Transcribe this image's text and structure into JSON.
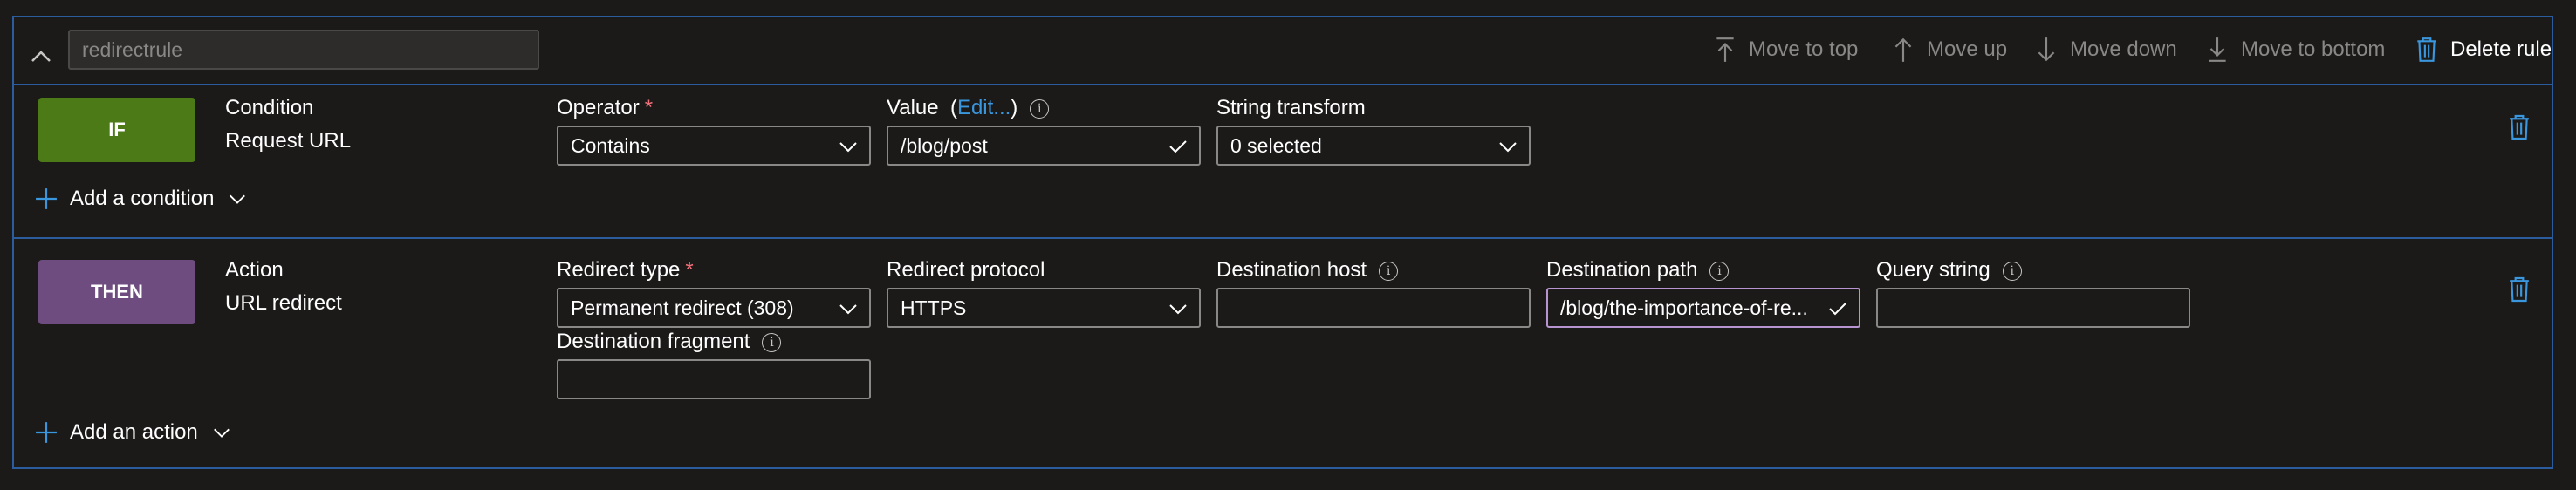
{
  "header": {
    "rule_name_placeholder": "redirectrule",
    "toolbar": {
      "move_to_top": "Move to top",
      "move_up": "Move up",
      "move_down": "Move down",
      "move_to_bottom": "Move to bottom",
      "delete_rule": "Delete rule"
    }
  },
  "condition": {
    "badge": "IF",
    "title": "Condition",
    "type": "Request URL",
    "operator_label": "Operator",
    "operator_value": "Contains",
    "value_label": "Value",
    "value_edit_link": "Edit...",
    "value_value": "/blog/post",
    "string_transform_label": "String transform",
    "string_transform_value": "0 selected",
    "add_label": "Add a condition"
  },
  "action": {
    "badge": "THEN",
    "title": "Action",
    "type": "URL redirect",
    "redirect_type_label": "Redirect type",
    "redirect_type_value": "Permanent redirect (308)",
    "redirect_protocol_label": "Redirect protocol",
    "redirect_protocol_value": "HTTPS",
    "destination_host_label": "Destination host",
    "destination_host_value": "",
    "destination_path_label": "Destination path",
    "destination_path_value": "/blog/the-importance-of-re...",
    "query_string_label": "Query string",
    "query_string_value": "",
    "destination_fragment_label": "Destination fragment",
    "destination_fragment_value": "",
    "add_label": "Add an action"
  },
  "colors": {
    "accent_border": "#2b5c9e",
    "if_badge": "#4b7a16",
    "then_badge": "#6e4c7f",
    "link": "#3a96dd",
    "required": "#f1707b",
    "focus_border": "#b794cf"
  }
}
